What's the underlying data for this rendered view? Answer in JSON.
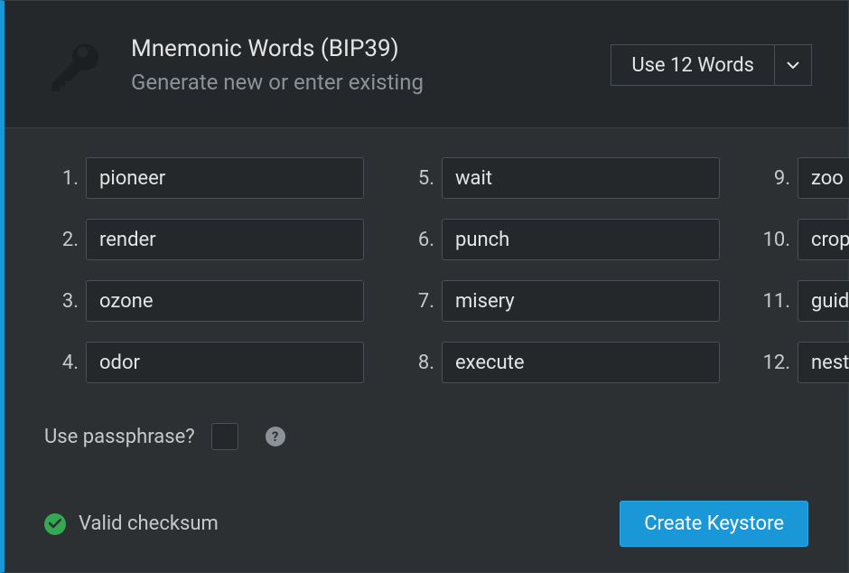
{
  "header": {
    "title": "Mnemonic Words (BIP39)",
    "subtitle": "Generate new or enter existing",
    "word_count_label": "Use 12 Words"
  },
  "words": [
    "pioneer",
    "render",
    "ozone",
    "odor",
    "wait",
    "punch",
    "misery",
    "execute",
    "zoo",
    "crop",
    "guide",
    "nest"
  ],
  "passphrase": {
    "label": "Use passphrase?",
    "checked": false
  },
  "status": {
    "valid_label": "Valid checksum"
  },
  "actions": {
    "create_keystore": "Create Keystore"
  },
  "colors": {
    "accent": "#1a97d6",
    "valid": "#34a853"
  }
}
